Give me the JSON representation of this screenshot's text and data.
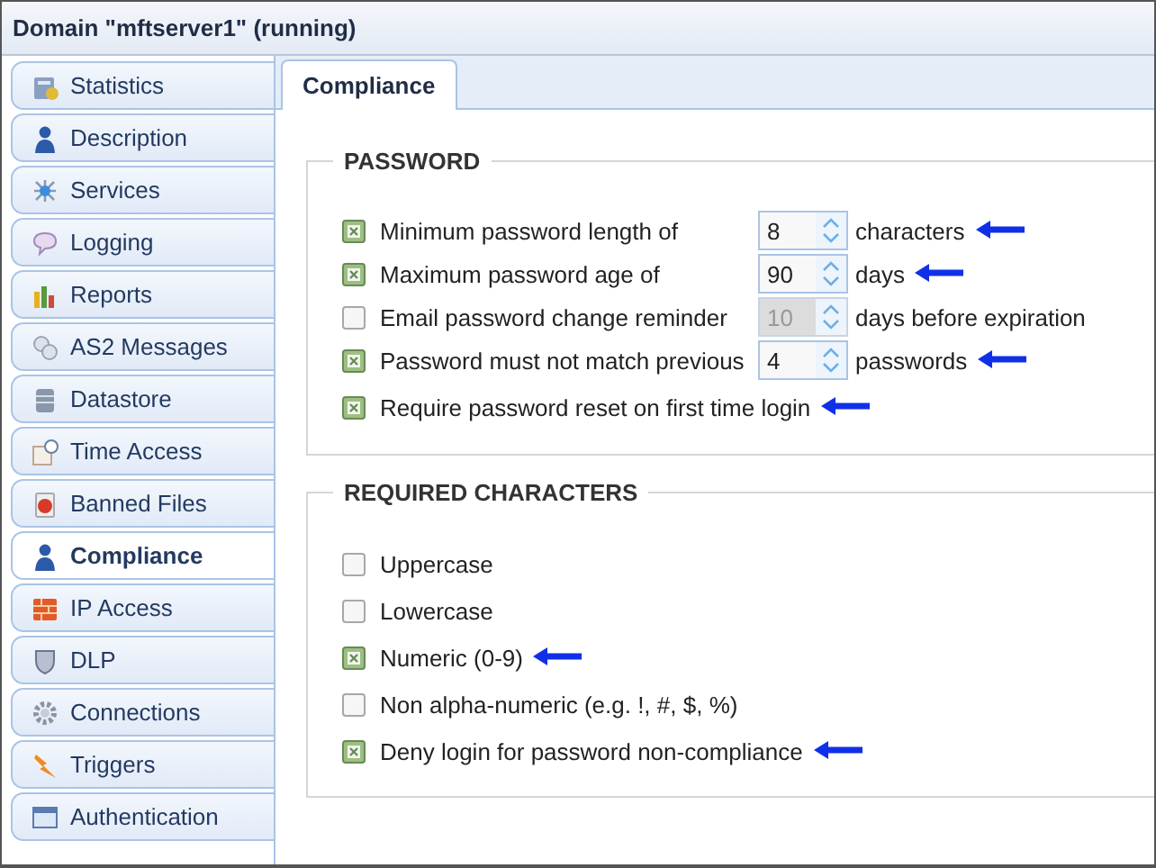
{
  "window": {
    "title": "Domain \"mftserver1\" (running)"
  },
  "sidebar": {
    "items": [
      {
        "label": "Statistics",
        "selected": false
      },
      {
        "label": "Description",
        "selected": false
      },
      {
        "label": "Services",
        "selected": false
      },
      {
        "label": "Logging",
        "selected": false
      },
      {
        "label": "Reports",
        "selected": false
      },
      {
        "label": "AS2 Messages",
        "selected": false
      },
      {
        "label": "Datastore",
        "selected": false
      },
      {
        "label": "Time Access",
        "selected": false
      },
      {
        "label": "Banned Files",
        "selected": false
      },
      {
        "label": "Compliance",
        "selected": true
      },
      {
        "label": "IP Access",
        "selected": false
      },
      {
        "label": "DLP",
        "selected": false
      },
      {
        "label": "Connections",
        "selected": false
      },
      {
        "label": "Triggers",
        "selected": false
      },
      {
        "label": "Authentication",
        "selected": false
      }
    ]
  },
  "tabs": [
    {
      "label": "Compliance",
      "selected": true
    }
  ],
  "sections": [
    {
      "title": "PASSWORD",
      "rows": [
        {
          "label": "Minimum password length of",
          "checked": true,
          "value": "8",
          "disabled": false,
          "unit": "characters",
          "annotated": true
        },
        {
          "label": "Maximum password age of",
          "checked": true,
          "value": "90",
          "disabled": false,
          "unit": "days",
          "annotated": true
        },
        {
          "label": "Email password change reminder",
          "checked": false,
          "value": "10",
          "disabled": true,
          "unit": "days before expiration",
          "annotated": false
        },
        {
          "label": "Password must not match previous",
          "checked": true,
          "value": "4",
          "disabled": false,
          "unit": "passwords",
          "annotated": true
        },
        {
          "label": "Require password reset on first time login",
          "checked": true,
          "annotated": true
        }
      ]
    },
    {
      "title": "REQUIRED CHARACTERS",
      "rows": [
        {
          "label": "Uppercase",
          "checked": false,
          "annotated": false
        },
        {
          "label": "Lowercase",
          "checked": false,
          "annotated": false
        },
        {
          "label": "Numeric (0-9)",
          "checked": true,
          "annotated": true
        },
        {
          "label": "Non alpha-numeric (e.g. !, #, $, %)",
          "checked": false,
          "annotated": false
        },
        {
          "label": "Deny login for password non-compliance",
          "checked": true,
          "annotated": true
        }
      ]
    }
  ]
}
